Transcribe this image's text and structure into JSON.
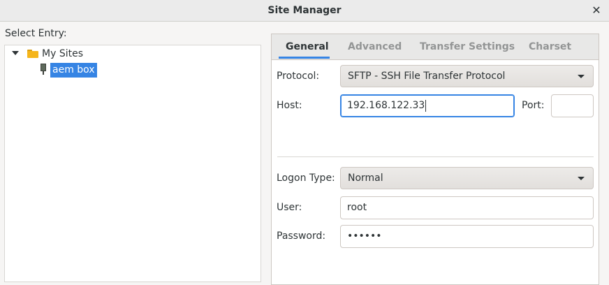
{
  "window": {
    "title": "Site Manager",
    "close_glyph": "✕"
  },
  "tree": {
    "label": "Select Entry:",
    "folder": {
      "label": "My Sites",
      "icon": "folder-icon",
      "expanded": true
    },
    "site": {
      "label": "aem box",
      "icon": "server-icon",
      "selected": true
    }
  },
  "tabs": [
    {
      "label": "General",
      "active": true
    },
    {
      "label": "Advanced",
      "active": false
    },
    {
      "label": "Transfer Settings",
      "active": false
    },
    {
      "label": "Charset",
      "active": false
    }
  ],
  "general": {
    "protocol_label": "Protocol:",
    "protocol_value": "SFTP - SSH File Transfer Protocol",
    "host_label": "Host:",
    "host_value": "192.168.122.33",
    "port_label": "Port:",
    "port_value": "",
    "logon_type_label": "Logon Type:",
    "logon_type_value": "Normal",
    "user_label": "User:",
    "user_value": "root",
    "password_label": "Password:",
    "password_value": "••••••"
  },
  "colors": {
    "accent": "#3584e4",
    "folder": "#f5b51a"
  }
}
